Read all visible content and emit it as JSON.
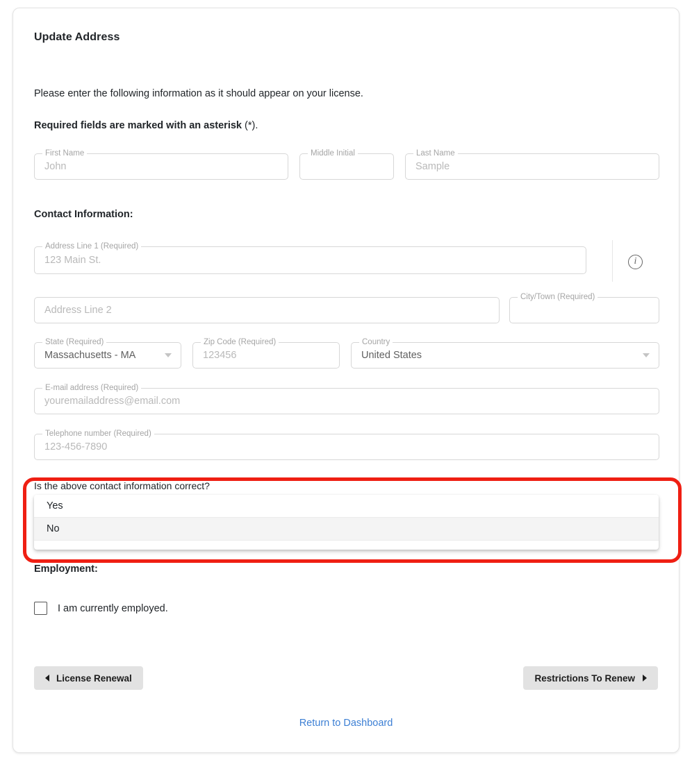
{
  "page": {
    "title": "Update Address",
    "intro": "Please enter the following information as it should appear on your license.",
    "required_note_bold": "Required fields are marked with an asterisk",
    "required_note_rest": " (*)."
  },
  "sections": {
    "contact_heading": "Contact Information:",
    "employment_heading": "Employment:"
  },
  "fields": {
    "first_name": {
      "label": "First Name",
      "value": "John"
    },
    "middle_initial": {
      "label": "Middle Initial",
      "value": ""
    },
    "last_name": {
      "label": "Last Name",
      "value": "Sample"
    },
    "address1": {
      "label": "Address Line 1 (Required)",
      "value": "123 Main St."
    },
    "address2": {
      "label": "",
      "value": "Address Line 2"
    },
    "city": {
      "label": "City/Town (Required)",
      "value": ""
    },
    "state": {
      "label": "State (Required)",
      "value": "Massachusetts - MA"
    },
    "zip": {
      "label": "Zip Code (Required)",
      "value": "123456"
    },
    "country": {
      "label": "Country",
      "value": "United States"
    },
    "email": {
      "label": "E-mail address (Required)",
      "value": "youremailaddress@email.com"
    },
    "phone": {
      "label": "Telephone number (Required)",
      "value": "123-456-7890"
    }
  },
  "icons": {
    "address_info": "i"
  },
  "dropdown": {
    "question": "Is the above contact information correct?",
    "options": [
      {
        "label": "Yes",
        "highlighted": false
      },
      {
        "label": "No",
        "highlighted": true
      }
    ]
  },
  "employment": {
    "checkbox_label": "I am currently employed.",
    "checked": false
  },
  "footer": {
    "prev_button": "License Renewal",
    "next_button": "Restrictions To Renew",
    "dashboard_link": "Return to Dashboard"
  },
  "colors": {
    "highlight_box": "#ef1f13",
    "link": "#3c7fd4",
    "button_bg": "#e2e2e2",
    "option_hover": "#f4f4f4"
  }
}
